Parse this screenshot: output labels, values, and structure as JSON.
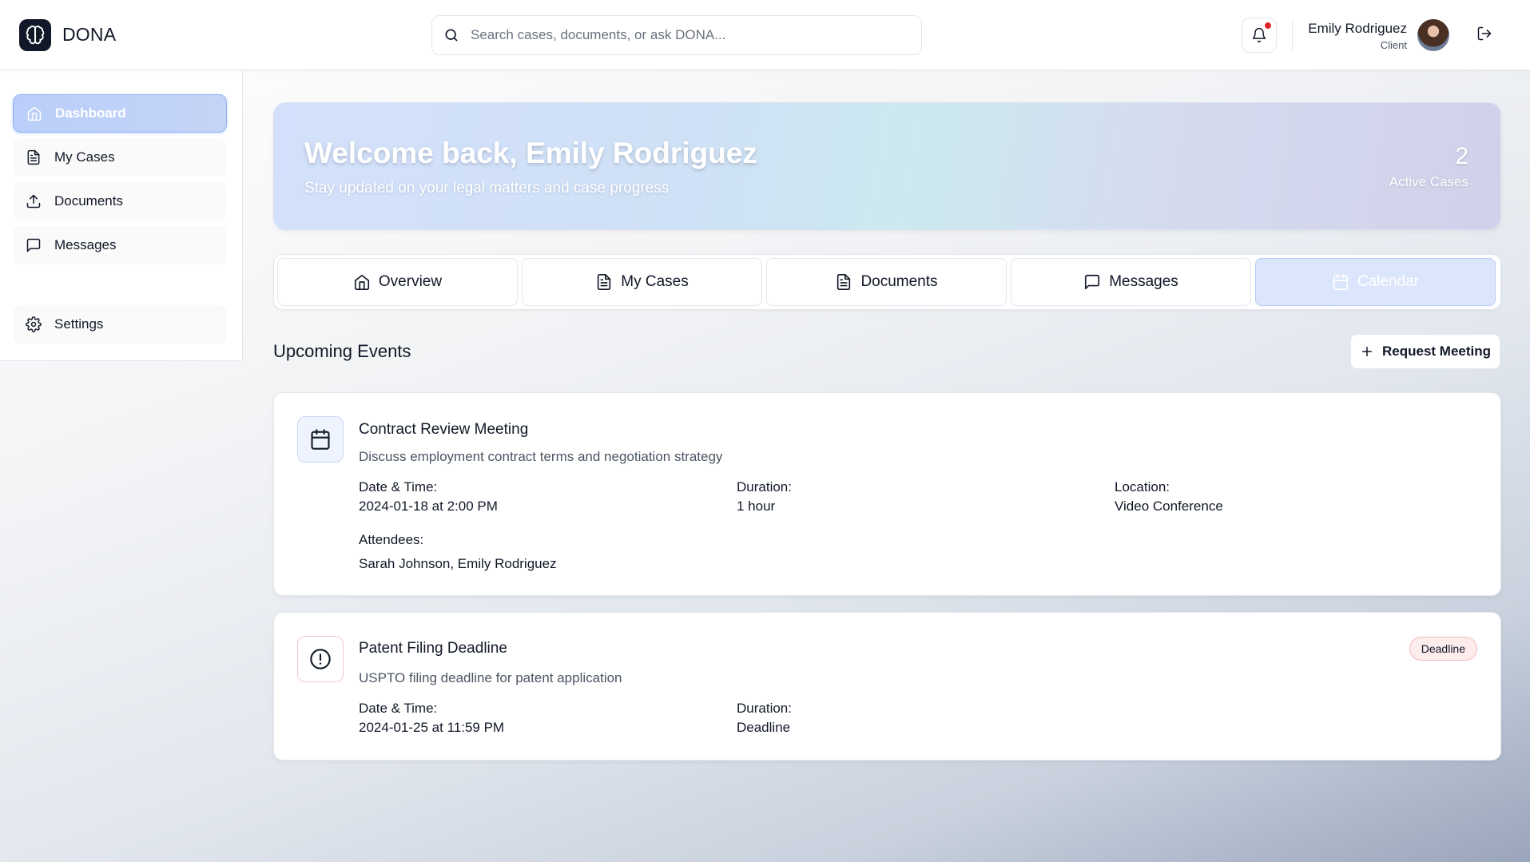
{
  "header": {
    "brand": "DONA",
    "search_placeholder": "Search cases, documents, or ask DONA...",
    "user_name": "Emily Rodriguez",
    "user_role": "Client"
  },
  "sidebar": {
    "items": [
      {
        "label": "Dashboard",
        "icon": "home-icon",
        "active": true
      },
      {
        "label": "My Cases",
        "icon": "file-icon"
      },
      {
        "label": "Documents",
        "icon": "upload-icon"
      },
      {
        "label": "Messages",
        "icon": "message-icon"
      },
      {
        "label": "Settings",
        "icon": "gear-icon"
      }
    ]
  },
  "welcome": {
    "title": "Welcome back, Emily Rodriguez",
    "subtitle": "Stay updated on your legal matters and case progress",
    "active_count": "2",
    "active_label": "Active Cases"
  },
  "tabs": [
    {
      "label": "Overview",
      "icon": "home-icon"
    },
    {
      "label": "My Cases",
      "icon": "file-icon"
    },
    {
      "label": "Documents",
      "icon": "file-icon"
    },
    {
      "label": "Messages",
      "icon": "message-icon"
    },
    {
      "label": "Calendar",
      "icon": "calendar-icon",
      "active": true
    }
  ],
  "events_section": {
    "title": "Upcoming Events",
    "request_button": "Request Meeting"
  },
  "events": [
    {
      "title": "Contract Review Meeting",
      "description": "Discuss employment contract terms and negotiation strategy",
      "icon": "calendar-icon",
      "datetime_label": "Date & Time:",
      "datetime": "2024-01-18 at 2:00 PM",
      "duration_label": "Duration:",
      "duration": "1 hour",
      "location_label": "Location:",
      "location": "Video Conference",
      "attendees_label": "Attendees:",
      "attendees": "Sarah Johnson, Emily Rodriguez"
    },
    {
      "title": "Patent Filing Deadline",
      "description": "USPTO filing deadline for patent application",
      "icon": "alert-circle-icon",
      "badge": "Deadline",
      "datetime_label": "Date & Time:",
      "datetime": "2024-01-25 at 11:59 PM",
      "duration_label": "Duration:",
      "duration": "Deadline"
    }
  ],
  "colors": {
    "accent": "#93b1f1",
    "deadline_badge_bg": "#fdecec",
    "notification_dot": "#dc2626"
  }
}
